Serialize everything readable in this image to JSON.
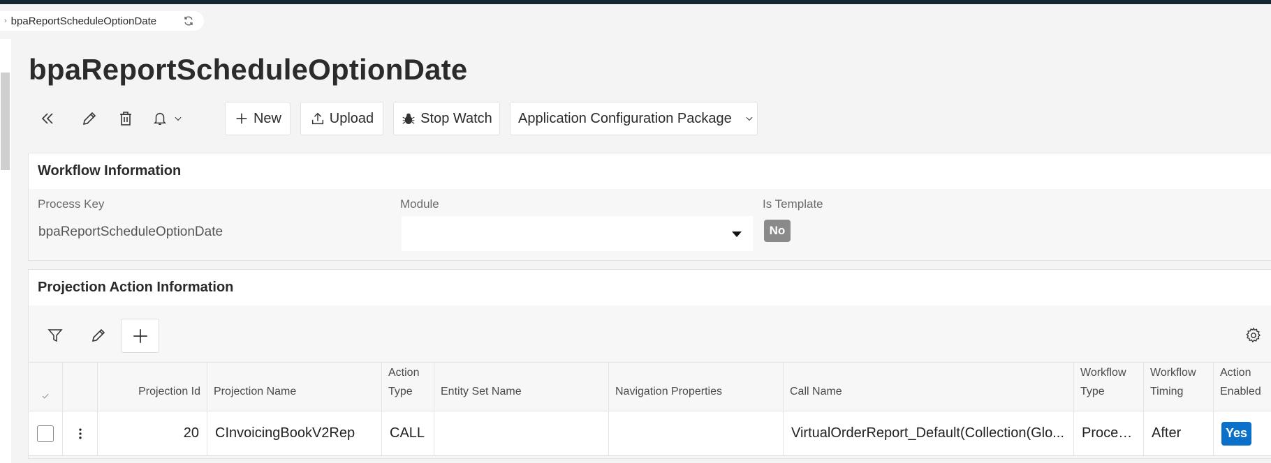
{
  "breadcrumb": {
    "label": "bpaReportScheduleOptionDate"
  },
  "page_title": "bpaReportScheduleOptionDate",
  "toolbar": {
    "new_label": "New",
    "upload_label": "Upload",
    "stopwatch_label": "Stop Watch",
    "config_package_label": "Application Configuration Package"
  },
  "workflow": {
    "title": "Workflow Information",
    "process_key_label": "Process Key",
    "process_key_value": "bpaReportScheduleOptionDate",
    "module_label": "Module",
    "module_value": "",
    "is_template_label": "Is Template",
    "is_template_value": "No"
  },
  "projection": {
    "title": "Projection Action Information",
    "columns": {
      "projection_id": "Projection Id",
      "projection_name": "Projection Name",
      "action_type": "Action Type",
      "entity_set_name": "Entity Set Name",
      "navigation_properties": "Navigation Properties",
      "call_name": "Call Name",
      "workflow_type": "Workflow Type",
      "workflow_timing": "Workflow Timing",
      "action_enabled": "Action Enabled"
    },
    "rows": [
      {
        "projection_id": "20",
        "projection_name": "CInvoicingBookV2Rep",
        "action_type": "CALL",
        "entity_set_name": "",
        "navigation_properties": "",
        "call_name": "VirtualOrderReport_Default(Collection(Glo...",
        "workflow_type": "Proces...",
        "workflow_timing": "After",
        "action_enabled": "Yes"
      }
    ]
  },
  "colors": {
    "topbar": "#152733",
    "accent_blue": "#0a70c9",
    "badge_gray": "#8a8a8a"
  }
}
